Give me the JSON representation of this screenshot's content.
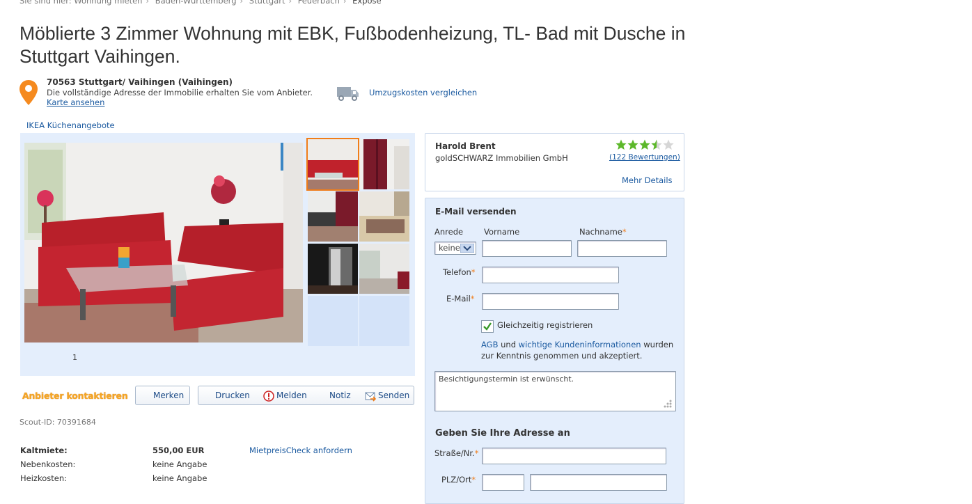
{
  "breadcrumb": {
    "prefix": "Sie sind hier:",
    "items": [
      "Wohnung mieten",
      "Baden-Württemberg",
      "Stuttgart",
      "Feuerbach"
    ],
    "current": "Exposé"
  },
  "listing": {
    "title": "Möblierte 3 Zimmer Wohnung mit EBK, Fußbodenheizung, TL- Bad mit Dusche in Stuttgart Vaihingen.",
    "address_line": "70563 Stuttgart/ Vaihingen (Vaihingen)",
    "address_note": "Die vollständige Adresse der Immobilie erhalten Sie vom Anbieter.",
    "map_link": "Karte ansehen",
    "moving_link": "Umzugskosten vergleichen",
    "ikea_link": "IKEA Küchenangebote",
    "gallery_page": "1",
    "scout_id": "Scout-ID: 70391684"
  },
  "actions": {
    "contact": "Anbieter kontaktieren",
    "merken": "Merken",
    "drucken": "Drucken",
    "melden": "Melden",
    "notiz": "Notiz",
    "senden": "Senden"
  },
  "prices": {
    "kalt_label": "Kaltmiete:",
    "kalt_value": "550,00 EUR",
    "check_link": "MietpreisCheck anfordern",
    "neben_label": "Nebenkosten:",
    "neben_value": "keine Angabe",
    "heiz_label": "Heizkosten:",
    "heiz_value": "keine Angabe"
  },
  "agent": {
    "name": "Harold Brent",
    "company": "goldSCHWARZ Immobilien GmbH",
    "rating": 3.5,
    "rating_max": 5,
    "reviews": "(122 Bewertungen)",
    "details": "Mehr Details"
  },
  "form": {
    "heading": "E-Mail versenden",
    "anrede_label": "Anrede",
    "anrede_value": "keine",
    "vorname_label": "Vorname",
    "nachname_label": "Nachname",
    "telefon_label": "Telefon",
    "email_label": "E-Mail",
    "register_label": "Gleichzeitig registrieren",
    "agb_link": "AGB",
    "agb_und": "und",
    "info_link": "wichtige Kundeninformationen",
    "agb_suffix": "wurden zur Kenntnis genommen und akzeptiert.",
    "message": "Besichtigungstermin ist erwünscht.",
    "address_heading": "Geben Sie Ihre Adresse an",
    "street_label": "Straße/Nr.",
    "plz_label": "PLZ/Ort"
  },
  "colors": {
    "accent_orange": "#f07d19",
    "link_blue": "#1b5aa0",
    "panel_blue": "#e4eefc",
    "star_green": "#5cb82a"
  }
}
